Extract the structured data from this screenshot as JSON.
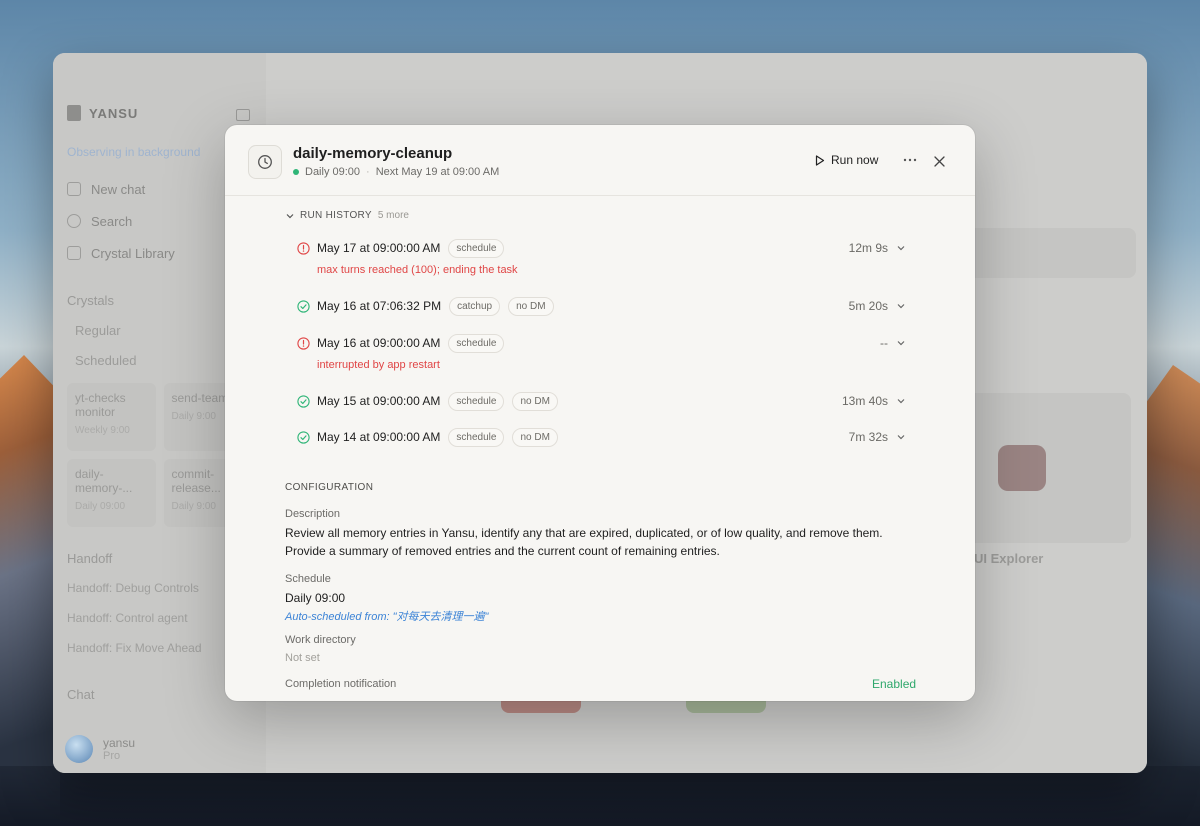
{
  "sidebar": {
    "brand": "YANSU",
    "status": "Observing in background",
    "nav": [
      {
        "label": "New chat",
        "icon": "chat-icon"
      },
      {
        "label": "Search",
        "icon": "search-icon"
      },
      {
        "label": "Crystal Library",
        "icon": "library-icon"
      }
    ],
    "section_crystals": "Crystals",
    "sub_regular": "Regular",
    "sub_scheduled": "Scheduled",
    "cards": [
      {
        "title": "yt-checks monitor",
        "sub": "Weekly 9:00"
      },
      {
        "title": "send-team ...",
        "sub": "Daily 9:00"
      },
      {
        "title": "daily-memory-...",
        "sub": "Daily 09:00"
      },
      {
        "title": "commit-release...",
        "sub": "Daily 9:00"
      }
    ],
    "section_handoff": "Handoff",
    "handoffs": [
      "Handoff: Debug Controls",
      "Handoff: Control agent",
      "Handoff: Fix Move Ahead"
    ],
    "section_chat": "Chat",
    "user": {
      "name": "yansu",
      "plan": "Pro"
    }
  },
  "main": {
    "explorer_label": "UI Explorer"
  },
  "modal": {
    "title": "daily-memory-cleanup",
    "schedule_short": "Daily 09:00",
    "next_run": "Next May 19 at 09:00 AM",
    "run_now": "Run now",
    "history": {
      "label": "RUN HISTORY",
      "more": "5 more",
      "runs": [
        {
          "status": "error",
          "date": "May 17 at 09:00:00 AM",
          "chips": [
            "schedule"
          ],
          "duration": "12m 9s",
          "error": "max turns reached (100); ending the task"
        },
        {
          "status": "success",
          "date": "May 16 at 07:06:32 PM",
          "chips": [
            "catchup",
            "no DM"
          ],
          "duration": "5m 20s",
          "error": ""
        },
        {
          "status": "error",
          "date": "May 16 at 09:00:00 AM",
          "chips": [
            "schedule"
          ],
          "duration": "--",
          "error": "interrupted by app restart"
        },
        {
          "status": "success",
          "date": "May 15 at 09:00:00 AM",
          "chips": [
            "schedule",
            "no DM"
          ],
          "duration": "13m 40s",
          "error": ""
        },
        {
          "status": "success",
          "date": "May 14 at 09:00:00 AM",
          "chips": [
            "schedule",
            "no DM"
          ],
          "duration": "7m 32s",
          "error": ""
        }
      ]
    },
    "config": {
      "label": "CONFIGURATION",
      "description_label": "Description",
      "description": "Review all memory entries in Yansu, identify any that are expired, duplicated, or of low quality, and remove them. Provide a summary of removed entries and the current count of remaining entries.",
      "schedule_label": "Schedule",
      "schedule_value": "Daily 09:00",
      "auto_scheduled": "Auto-scheduled from: \"对每天去清理一遍\"",
      "workdir_label": "Work directory",
      "workdir_value": "Not set",
      "notification_label": "Completion notification",
      "notification_value": "Enabled"
    }
  },
  "colors": {
    "error": "#e04646",
    "success": "#2fb577",
    "link": "#3b83d6"
  }
}
